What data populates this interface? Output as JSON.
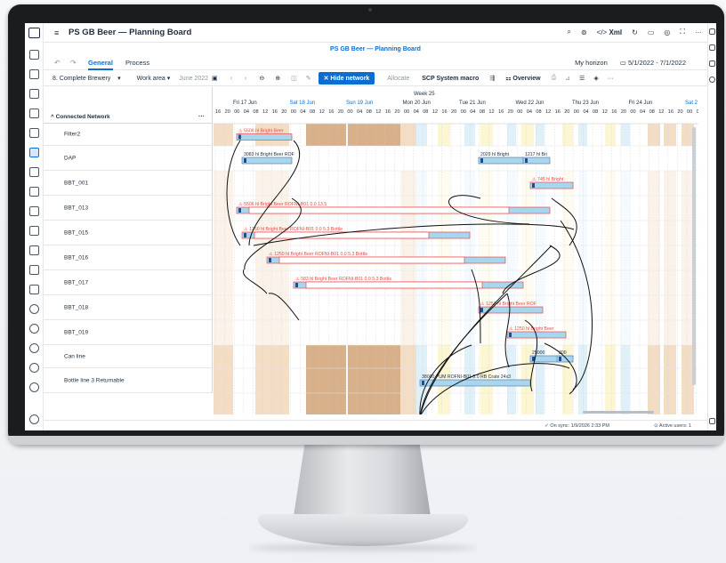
{
  "app": {
    "title": "PS GB Beer — Planning Board",
    "subtitle": "PS GB Beer — Planning Board",
    "xml_label": "Xml"
  },
  "tabs": [
    {
      "label": "General",
      "active": true
    },
    {
      "label": "Process",
      "active": false
    }
  ],
  "horizon": {
    "label": "My horizon",
    "range": "5/1/2022 - 7/1/2022"
  },
  "toolbar": {
    "scenario": "8. Complete Brewery",
    "work_area": "Work area",
    "date": "June 2022",
    "hide_network": "Hide network",
    "allocate": "Allocate",
    "scp_macro": "SCP System macro",
    "overview": "Overview"
  },
  "gantt": {
    "tree_header": "Connected Network",
    "week_label": "Week 25",
    "days": [
      {
        "label": "Fri 17 Jun",
        "weekend": false
      },
      {
        "label": "Sat 18 Jun",
        "weekend": true
      },
      {
        "label": "Sun 19 Jun",
        "weekend": true
      },
      {
        "label": "Mon 20 Jun",
        "weekend": false
      },
      {
        "label": "Tue 21 Jun",
        "weekend": false
      },
      {
        "label": "Wed 22 Jun",
        "weekend": false
      },
      {
        "label": "Thu 23 Jun",
        "weekend": false
      },
      {
        "label": "Fri 24 Jun",
        "weekend": false
      },
      {
        "label": "Sat 2",
        "weekend": true
      }
    ],
    "hours": [
      "16",
      "20",
      "00",
      "04",
      "08",
      "12",
      "16",
      "20",
      "00",
      "04",
      "08",
      "12",
      "16",
      "20",
      "00",
      "04",
      "08",
      "12",
      "16",
      "20",
      "00",
      "04",
      "08",
      "12",
      "16",
      "20",
      "00",
      "04",
      "08",
      "12",
      "16",
      "20",
      "00",
      "04",
      "08",
      "12",
      "16",
      "20",
      "00",
      "04",
      "08",
      "12",
      "16",
      "20",
      "00",
      "04",
      "08",
      "12",
      "16",
      "20",
      "00",
      "04",
      "08",
      "12",
      "16",
      "20"
    ],
    "resources": [
      "Filter2",
      "DAP",
      "BBT_001",
      "BBT_013",
      "BBT_015",
      "BBT_016",
      "BBT_017",
      "BBT_018",
      "BBT_019",
      "Can line",
      "Bottle line 3 Returnable"
    ],
    "orders": [
      {
        "label": "5506 hl Bright Beer"
      },
      {
        "label": "3083 hl Bright Beer ROF"
      },
      {
        "label": "2029 hl Bright"
      },
      {
        "label": "1217 hl Bri"
      },
      {
        "label": "745 hl Bright"
      },
      {
        "label": "5506 hl Bright Beer ROFNI-B01 0.0 13.5"
      },
      {
        "label": "1250 hl Bright Beer ROFNI-B01 0.0 5.3 Bottle"
      },
      {
        "label": "1250 hl Bright Beer ROFNI-B01 0.0 5.3 Bottle"
      },
      {
        "label": "583 hl Bright Beer ROFNI-B01 0.0 5.3 Bottle"
      },
      {
        "label": "1250 hl Bright Beer ROF"
      },
      {
        "label": "1250 hl Bright Beer"
      },
      {
        "label": "25000"
      },
      {
        "label": "300"
      },
      {
        "label": "38000 PUM ROFNI-B01 0.0 RB Crate 24x3"
      }
    ]
  },
  "status": {
    "sync": "On sync: 1/9/2026 2:33 PM",
    "users": "Active users: 1"
  },
  "colors": {
    "accent": "#0a6ed1",
    "bar_fill": "#a9d6ee",
    "bar_outline": "#e24c4b",
    "weekend": "#f3ddc4",
    "weekend_dark": "#d8b08a",
    "light_blue": "#dff0f8",
    "light_yellow": "#fdf6d3"
  }
}
